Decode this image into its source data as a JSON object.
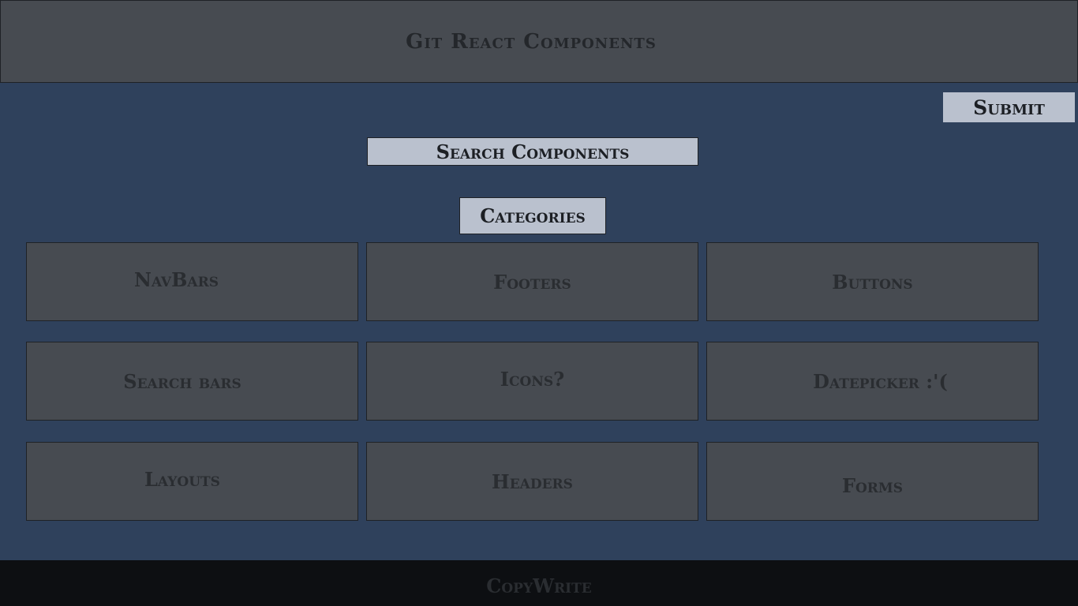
{
  "header": {
    "title": "Git React Components"
  },
  "toolbar": {
    "submit_label": "Submit"
  },
  "search": {
    "placeholder": "Search Components",
    "value": ""
  },
  "categories": {
    "label": "Categories",
    "items": [
      {
        "label": "NavBars"
      },
      {
        "label": "Footers"
      },
      {
        "label": "Buttons"
      },
      {
        "label": "Search bars"
      },
      {
        "label": "Icons?"
      },
      {
        "label": "Datepicker :'("
      },
      {
        "label": "Layouts"
      },
      {
        "label": "Headers"
      },
      {
        "label": "Forms"
      }
    ]
  },
  "footer": {
    "text": "CopyWrite"
  },
  "colors": {
    "background": "#2f415c",
    "panel": "#474b51",
    "light_control": "#bac1ce",
    "footer": "#0d0f12"
  }
}
